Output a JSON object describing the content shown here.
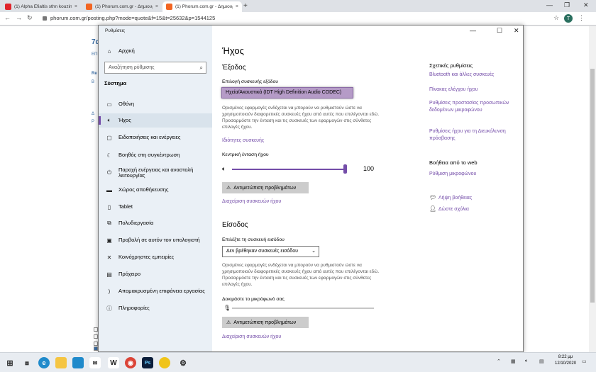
{
  "browser": {
    "tabs": [
      {
        "title": "(1) Alpha Efialtis sthn kouzina...",
        "fav_color": "#e0242b"
      },
      {
        "title": "(1) Phorum.com.gr - Δημιουργία...",
        "fav_color": "#f26522"
      },
      {
        "title": "(1) Phorum.com.gr - Δημιουργία...",
        "fav_color": "#f26522"
      }
    ],
    "url": "phorum.com.gr/posting.php?mode=quote&f=15&t=25632&p=1544125",
    "profile_initial": "T",
    "page_fragments": [
      "7α",
      "ΕΠΙ",
      "Re",
      "Β",
      "Δ",
      "Ρ"
    ]
  },
  "window": {
    "title": "Ρυθμίσεις"
  },
  "sidebar": {
    "home": "Αρχική",
    "search_placeholder": "Αναζήτηση ρύθμισης",
    "section": "Σύστημα",
    "items": [
      {
        "label": "Οθόνη",
        "icon": "display-icon"
      },
      {
        "label": "Ήχος",
        "icon": "speaker-icon",
        "selected": true
      },
      {
        "label": "Ειδοποιήσεις και ενέργειες",
        "icon": "notifications-icon"
      },
      {
        "label": "Βοηθός στη συγκέντρωση",
        "icon": "focus-assist-icon"
      },
      {
        "label": "Παροχή ενέργειας και αναστολή λειτουργίας",
        "icon": "power-icon"
      },
      {
        "label": "Χώρος αποθήκευσης",
        "icon": "storage-icon"
      },
      {
        "label": "Tablet",
        "icon": "tablet-icon"
      },
      {
        "label": "Πολυδιεργασία",
        "icon": "multitasking-icon"
      },
      {
        "label": "Προβολή σε αυτόν τον υπολογιστή",
        "icon": "projecting-icon"
      },
      {
        "label": "Κοινόχρηστες εμπειρίες",
        "icon": "shared-experiences-icon"
      },
      {
        "label": "Πρόχειρο",
        "icon": "clipboard-icon"
      },
      {
        "label": "Απομακρυσμένη επιφάνεια εργασίας",
        "icon": "remote-desktop-icon"
      },
      {
        "label": "Πληροφορίες",
        "icon": "info-icon"
      }
    ]
  },
  "main": {
    "title": "Ήχος",
    "output": {
      "heading": "Έξοδος",
      "device_label": "Επιλογή συσκευής εξόδου",
      "device_value": "Ηχεία/Ακουστικά (IDT High Definition Audio CODEC)",
      "description": "Ορισμένες εφαρμογές ενδέχεται να μπορούν να ρυθμιστούν ώστε να χρησιμοποιούν διαφορετικές συσκευές ήχου από αυτές που επιλέγονται εδώ. Προσαρμόστε την ένταση και τις συσκευές των εφαρμογών στις σύνθετες επιλογές ήχου.",
      "properties_link": "Ιδιότητες συσκευής",
      "volume_label": "Κεντρική ένταση ήχου",
      "volume_value": "100",
      "volume_level": 1.0,
      "troubleshoot": "Αντιμετώπιση προβλημάτων",
      "manage_link": "Διαχείριση συσκευών ήχου"
    },
    "input": {
      "heading": "Είσοδος",
      "device_label": "Επιλέξτε τη συσκευή εισόδου",
      "device_value": "Δεν βρέθηκαν συσκευές εισόδου",
      "description": "Ορισμένες εφαρμογές ενδέχεται να μπορούν να ρυθμιστούν ώστε να χρησιμοποιούν διαφορετικές συσκευές ήχου από αυτές που επιλέγονται εδώ. Προσαρμόστε την ένταση και τις συσκευές των εφαρμογών στις σύνθετες επιλογές ήχου.",
      "mic_test_label": "Δοκιμάστε το μικρόφωνό σας",
      "mic_level": 0.0,
      "troubleshoot": "Αντιμετώπιση προβλημάτων",
      "manage_link": "Διαχείριση συσκευών ήχου"
    }
  },
  "related": {
    "heading": "Σχετικές ρυθμίσεις",
    "links": [
      "Bluetooth και άλλες συσκευές",
      "Πίνακας ελέγχου ήχου",
      "Ρυθμίσεις προστασίας προσωπικών δεδομένων μικροφώνου",
      "Ρυθμίσεις ήχου για τη Διευκόλυνση πρόσβασης"
    ],
    "help_heading": "Βοήθεια από το web",
    "help_link": "Ρύθμιση μικροφώνου",
    "get_help": "Λήψη βοήθειας",
    "feedback": "Δώστε σχόλια"
  },
  "taskbar": {
    "time": "8:22 μμ",
    "date": "12/10/2020"
  },
  "colors": {
    "accent": "#744da9",
    "sidebar_bg": "#eaf0f6"
  }
}
